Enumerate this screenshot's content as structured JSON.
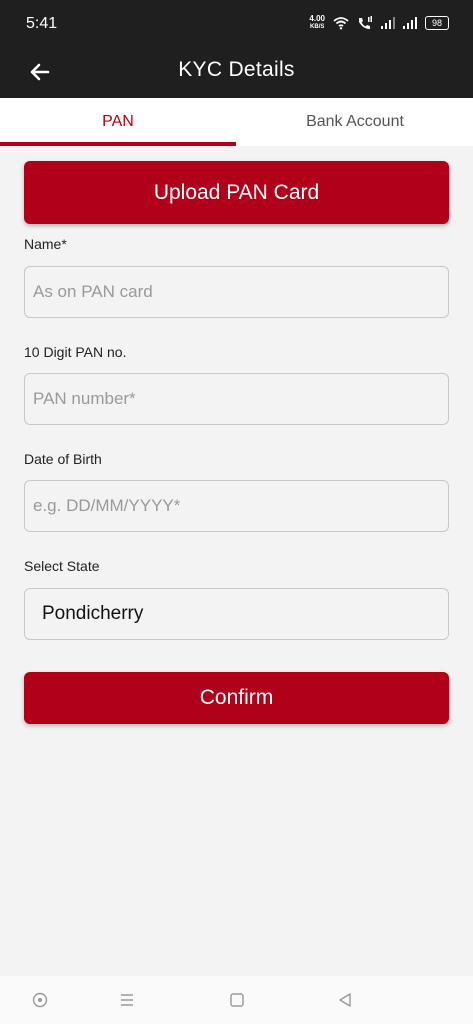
{
  "status": {
    "time": "5:41",
    "net_speed_value": "4.00",
    "net_speed_unit": "KB/S",
    "battery": "98"
  },
  "appbar": {
    "title": "KYC Details"
  },
  "tabs": [
    {
      "label": "PAN",
      "active": true
    },
    {
      "label": "Bank Account",
      "active": false
    }
  ],
  "colors": {
    "accent": "#b1001a",
    "bar": "#1f1f1f"
  },
  "upload_button": {
    "label": "Upload PAN Card"
  },
  "form": {
    "name": {
      "label": "Name*",
      "placeholder": "As on PAN card"
    },
    "pan": {
      "label": "10 Digit PAN no.",
      "placeholder": "PAN number*"
    },
    "dob": {
      "label": "Date of Birth",
      "placeholder": "e.g. DD/MM/YYYY*"
    },
    "state": {
      "label": "Select State",
      "value": "Pondicherry"
    }
  },
  "confirm_button": {
    "label": "Confirm"
  },
  "navbar": {
    "icons": [
      "home-icon",
      "menu-icon",
      "square-icon",
      "back-triangle-icon"
    ]
  }
}
